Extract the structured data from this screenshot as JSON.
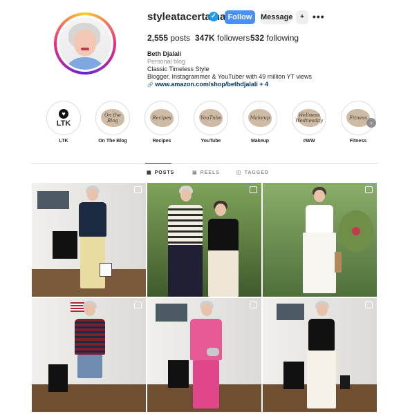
{
  "profile": {
    "username": "styleatacertainage",
    "verified_glyph": "✓",
    "follow_label": "Follow",
    "message_label": "Message",
    "suggest_glyph": "+",
    "more_glyph": "•••",
    "stats": {
      "posts_count": "2,555",
      "posts_label": "posts",
      "followers_count": "347K",
      "followers_label": "followers",
      "following_count": "532",
      "following_label": "following"
    },
    "bio": {
      "name": "Beth Djalali",
      "category": "Personal blog",
      "line1": "Classic Timeless Style",
      "line2": "Blogger, Instagrammer & YouTuber with 49 million YT views",
      "link_glyph": "🔗",
      "link": "www.amazon.com/shop/bethdjalali + 4"
    }
  },
  "highlights": [
    {
      "label": "LTK",
      "cover": "LTK"
    },
    {
      "label": "On The Blog",
      "cover": "On the Blog"
    },
    {
      "label": "Recipes",
      "cover": "Recipes"
    },
    {
      "label": "YouTube",
      "cover": "YouTube"
    },
    {
      "label": "Makeup",
      "cover": "Makeup"
    },
    {
      "label": "#WW",
      "cover": "Wellness Wednesday"
    },
    {
      "label": "Fitness",
      "cover": "Fitness"
    }
  ],
  "highlights_next_glyph": "›",
  "tabs": [
    {
      "label": "POSTS",
      "icon": "▦"
    },
    {
      "label": "REELS",
      "icon": "▣"
    },
    {
      "label": "TAGGED",
      "icon": "◫"
    }
  ],
  "colors": {
    "follow_button": "#4a90f7",
    "link": "#00376b",
    "verified": "#1d9bf0"
  }
}
